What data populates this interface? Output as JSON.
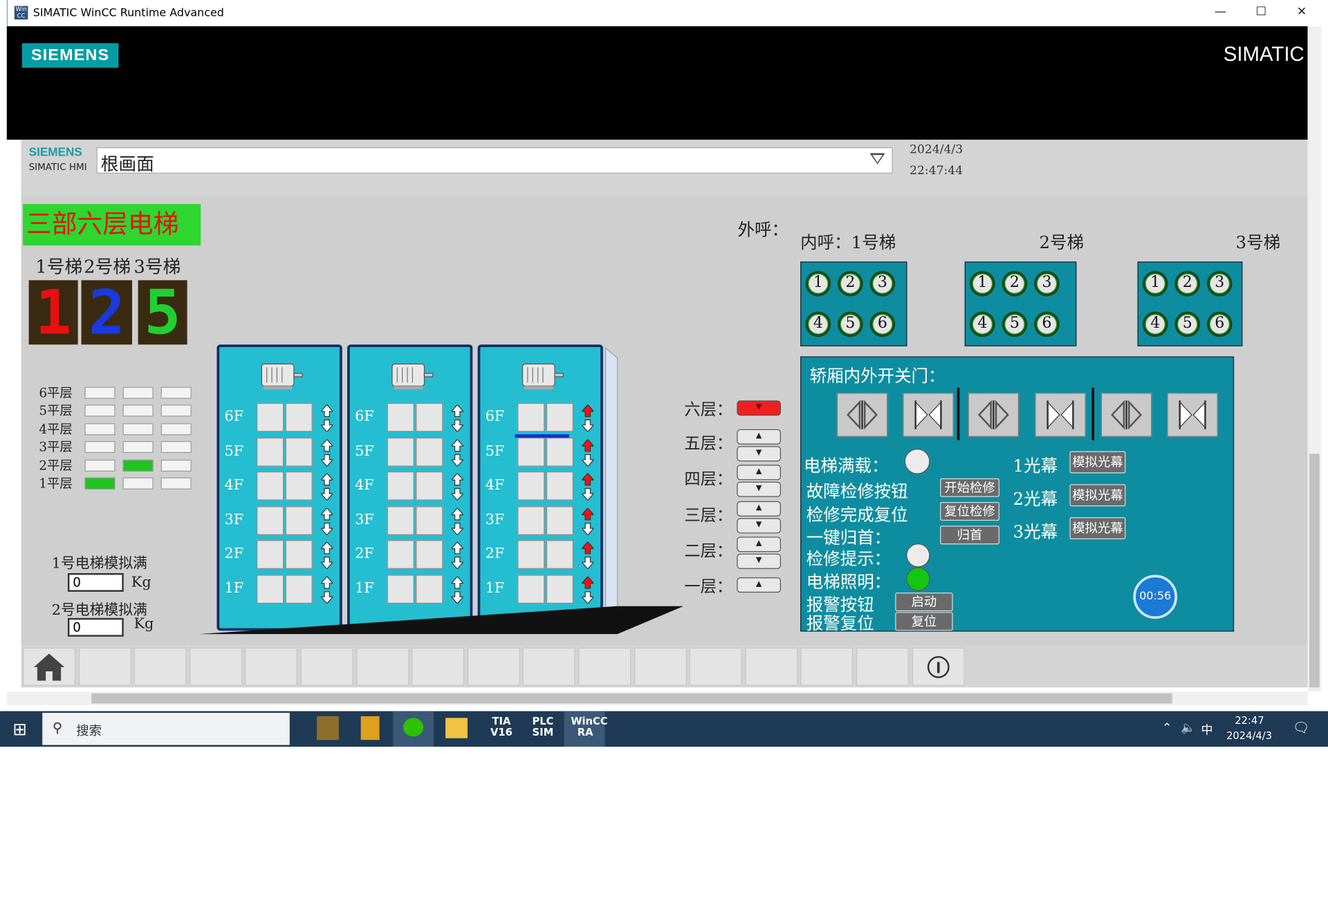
{
  "window": {
    "title": "SIMATIC WinCC Runtime Advanced",
    "minimize": "—",
    "maximize": "☐",
    "close": "✕"
  },
  "brand": {
    "siemens": "SIEMENS",
    "simatic": "SIMATIC"
  },
  "header": {
    "siemens": "SIEMENS",
    "simatic_hmi": "SIMATIC HMI",
    "screen_name": "根画面",
    "date": "2024/4/3",
    "time": "22:47:44"
  },
  "main": {
    "title": "三部六层电梯",
    "elevator_labels": [
      "1号梯",
      "2号梯",
      "3号梯"
    ],
    "floor_digits": [
      "1",
      "2",
      "5"
    ],
    "digit_colors": [
      "#e81010",
      "#1a3ae0",
      "#20d030"
    ],
    "level_rows": [
      {
        "label": "6平层",
        "state": [
          0,
          0,
          0
        ]
      },
      {
        "label": "5平层",
        "state": [
          0,
          0,
          0
        ]
      },
      {
        "label": "4平层",
        "state": [
          0,
          0,
          0
        ]
      },
      {
        "label": "3平层",
        "state": [
          0,
          0,
          0
        ]
      },
      {
        "label": "2平层",
        "state": [
          0,
          1,
          0
        ]
      },
      {
        "label": "1平层",
        "state": [
          1,
          0,
          0
        ]
      }
    ],
    "weight1": {
      "label": "1号电梯模拟满",
      "value": "0",
      "unit": "Kg"
    },
    "weight2": {
      "label": "2号电梯模拟满",
      "value": "0",
      "unit": "Kg"
    },
    "shaft_floors": [
      "6F",
      "5F",
      "4F",
      "3F",
      "2F",
      "1F"
    ],
    "outer_call_label": "外呼：",
    "outer_calls": [
      {
        "label": "六层：",
        "buttons": [
          "down"
        ],
        "active": true
      },
      {
        "label": "五层：",
        "buttons": [
          "up",
          "down"
        ],
        "active": false
      },
      {
        "label": "四层：",
        "buttons": [
          "up",
          "down"
        ],
        "active": false
      },
      {
        "label": "三层：",
        "buttons": [
          "up",
          "down"
        ],
        "active": false
      },
      {
        "label": "二层：",
        "buttons": [
          "up",
          "down"
        ],
        "active": false
      },
      {
        "label": "一层：",
        "buttons": [
          "up"
        ],
        "active": false
      }
    ],
    "inner_call_label": "内呼：1号梯",
    "elevator2_label": "2号梯",
    "elevator3_label": "3号梯",
    "inner_numbers": [
      "1",
      "2",
      "3",
      "4",
      "5",
      "6"
    ],
    "door_panel_title": "轿厢内外开关门：",
    "full_load_label": "电梯满载：",
    "fault_label": "故障检修按钮",
    "fault_button": "开始检修",
    "repair_label": "检修完成复位",
    "repair_button": "复位检修",
    "home_label": "一键归首：",
    "home_button": "归首",
    "maint_label": "检修提示：",
    "light_label": "电梯照明：",
    "alarm_label": "报警按钮",
    "alarm_button": "启动",
    "reset_label": "报警复位",
    "reset_button": "复位",
    "curtains": [
      {
        "label": "1光幕",
        "button": "模拟光幕"
      },
      {
        "label": "2光幕",
        "button": "模拟光幕"
      },
      {
        "label": "3光幕",
        "button": "模拟光幕"
      }
    ],
    "timer": "00:56"
  },
  "taskbar": {
    "search": "搜索",
    "tia": "TIA V16",
    "plc": "PLC SIM",
    "wincc": "WinCC RA",
    "ime": "中",
    "clock_time": "22:47",
    "clock_date": "2024/4/3"
  }
}
